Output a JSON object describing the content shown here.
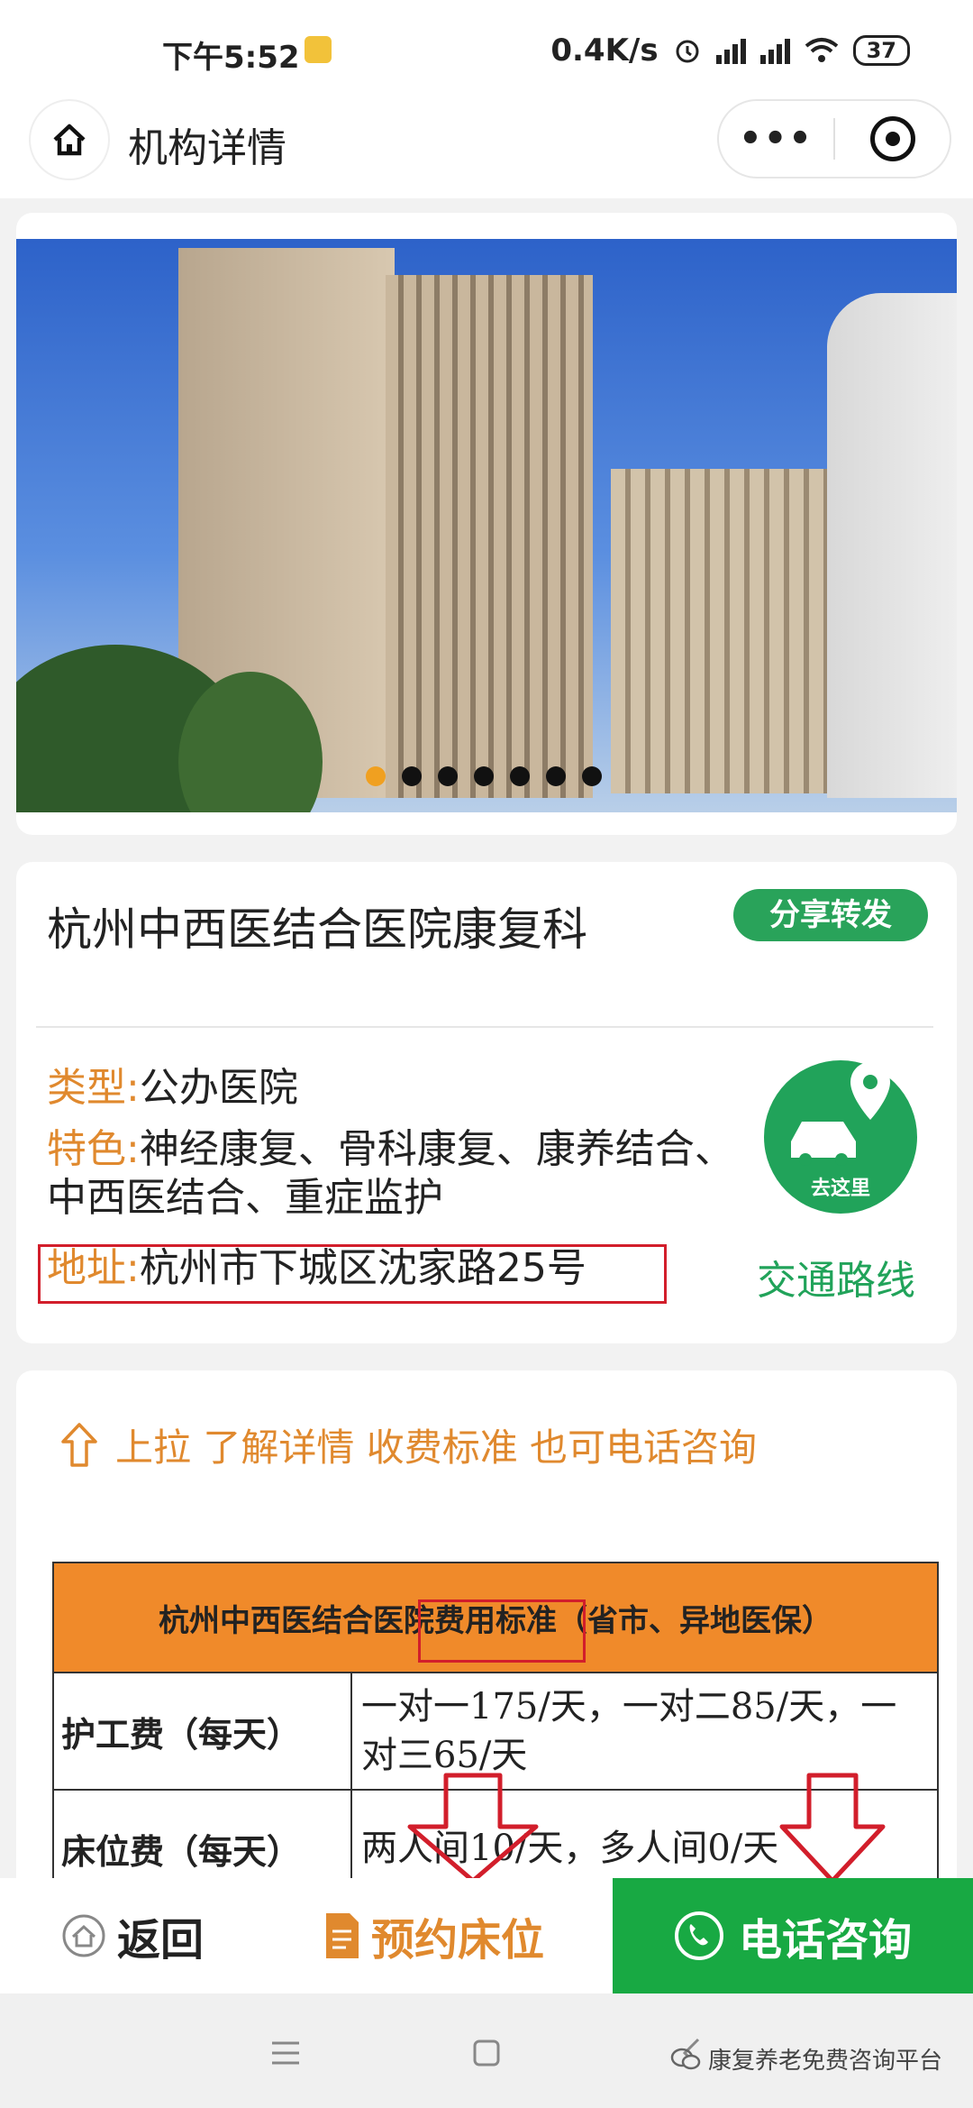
{
  "status_bar": {
    "time": "下午5:52",
    "net_speed": "0.4K/s",
    "battery": "37"
  },
  "navbar": {
    "title": "机构详情",
    "more": "•••"
  },
  "carousel": {
    "slide_count": 7,
    "active_slide": 1
  },
  "institution": {
    "name": "杭州中西医结合医院康复科",
    "share_label": "分享转发",
    "type_key": "类型:",
    "type_value": "公办医院",
    "feature_key": "特色:",
    "feature_value": "神经康复、骨科康复、康养结合、中西医结合、重症监护",
    "address_key": "地址:",
    "address_value": "杭州市下城区沈家路25号",
    "goto_label": "去这里",
    "route_label": "交通路线"
  },
  "pricing": {
    "hint": "上拉 了解详情 收费标准 也可电话咨询",
    "table_title": "杭州中西医结合医院费用标准（省市、异地医保）",
    "rows": [
      {
        "label": "护工费（每天）",
        "value": "一对一175/天，一对二85/天，一对三65/天"
      },
      {
        "label": "床位费（每天）",
        "value": "两人间10/天，多人间0/天"
      }
    ]
  },
  "bottom_bar": {
    "back": "返回",
    "book_bed": "预约床位",
    "call": "电话咨询"
  },
  "watermark": "康复养老免费咨询平台",
  "colors": {
    "accent_orange": "#e0892e",
    "green": "#21a35a",
    "call_green": "#18a943",
    "highlight_red": "#d21e2b"
  }
}
